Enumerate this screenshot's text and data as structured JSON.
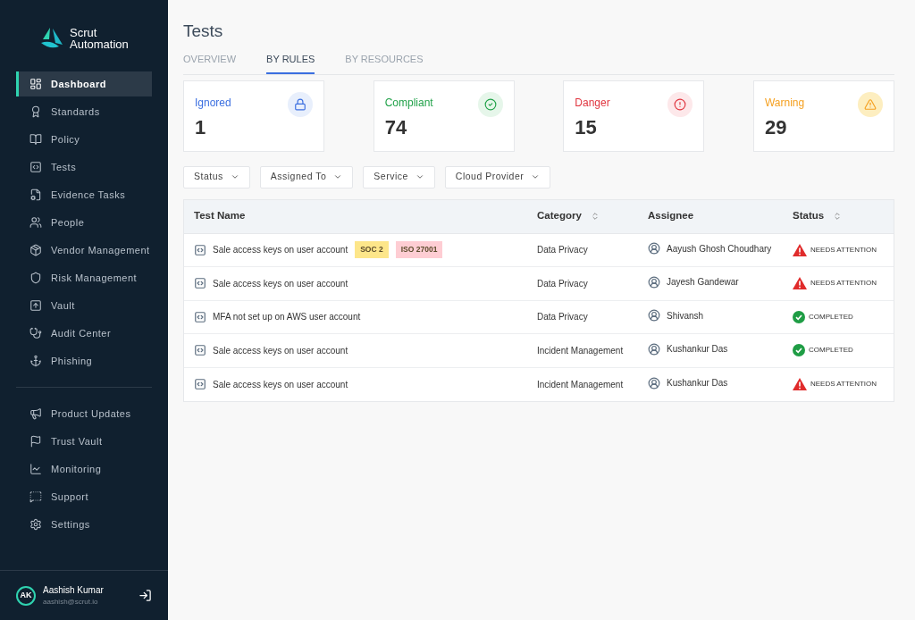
{
  "sidebar": {
    "logo": {
      "line1": "Scrut",
      "line2": "Automation"
    },
    "items": [
      {
        "label": "Dashboard",
        "selected": true
      },
      {
        "label": "Standards",
        "selected": false
      },
      {
        "label": "Policy",
        "selected": false
      },
      {
        "label": "Tests",
        "selected": false
      },
      {
        "label": "Evidence Tasks",
        "selected": false
      },
      {
        "label": "People",
        "selected": false
      },
      {
        "label": "Vendor Management",
        "selected": false
      },
      {
        "label": "Risk Management",
        "selected": false
      },
      {
        "label": "Vault",
        "selected": false
      },
      {
        "label": "Audit Center",
        "selected": false
      },
      {
        "label": "Phishing",
        "selected": false
      }
    ],
    "bottom_items": [
      {
        "label": "Product Updates"
      },
      {
        "label": "Trust Vault"
      },
      {
        "label": "Monitoring"
      },
      {
        "label": "Support"
      },
      {
        "label": "Settings"
      }
    ],
    "user": {
      "initials": "AK",
      "name": "Aashish Kumar",
      "email": "aashish@scrut.io"
    }
  },
  "page": {
    "title": "Tests",
    "tabs": [
      {
        "label": "OVERVIEW",
        "selected": false
      },
      {
        "label": "BY RULES",
        "selected": true
      },
      {
        "label": "BY RESOURCES",
        "selected": false
      }
    ],
    "stats": [
      {
        "kind": "ignored",
        "label": "Ignored",
        "value": "1"
      },
      {
        "kind": "compliant",
        "label": "Compliant",
        "value": "74"
      },
      {
        "kind": "danger",
        "label": "Danger",
        "value": "15"
      },
      {
        "kind": "warning",
        "label": "Warning",
        "value": "29"
      }
    ],
    "filters": [
      "Status",
      "Assigned To",
      "Service",
      "Cloud Provider"
    ],
    "table": {
      "columns": [
        {
          "label": "Test Name",
          "sortable": false
        },
        {
          "label": "Category",
          "sortable": true
        },
        {
          "label": "Assignee",
          "sortable": false
        },
        {
          "label": "Status",
          "sortable": true
        }
      ],
      "rows": [
        {
          "name": "Sale access keys on user account",
          "tags": [
            {
              "label": "SOC 2",
              "color": "#fde68a"
            },
            {
              "label": "ISO 27001",
              "color": "#fecdd3"
            }
          ],
          "category": "Data Privacy",
          "assignee": "Aayush Ghosh Choudhary",
          "status": {
            "kind": "needs_attention",
            "label": "NEEDS ATTENTION"
          }
        },
        {
          "name": "Sale access keys on user account",
          "category": "Data Privacy",
          "assignee": "Jayesh Gandewar",
          "status": {
            "kind": "needs_attention",
            "label": "NEEDS ATTENTION"
          }
        },
        {
          "name": "MFA not set up on AWS user account",
          "category": "Data Privacy",
          "assignee": "Shivansh",
          "status": {
            "kind": "completed",
            "label": "COMPLETED"
          }
        },
        {
          "name": "Sale access keys on user account",
          "category": "Incident Management",
          "assignee": "Kushankur Das",
          "status": {
            "kind": "completed",
            "label": "COMPLETED"
          }
        },
        {
          "name": "Sale access keys on user account",
          "category": "Incident Management",
          "assignee": "Kushankur Das",
          "status": {
            "kind": "needs_attention",
            "label": "NEEDS ATTENTION"
          }
        }
      ]
    }
  }
}
